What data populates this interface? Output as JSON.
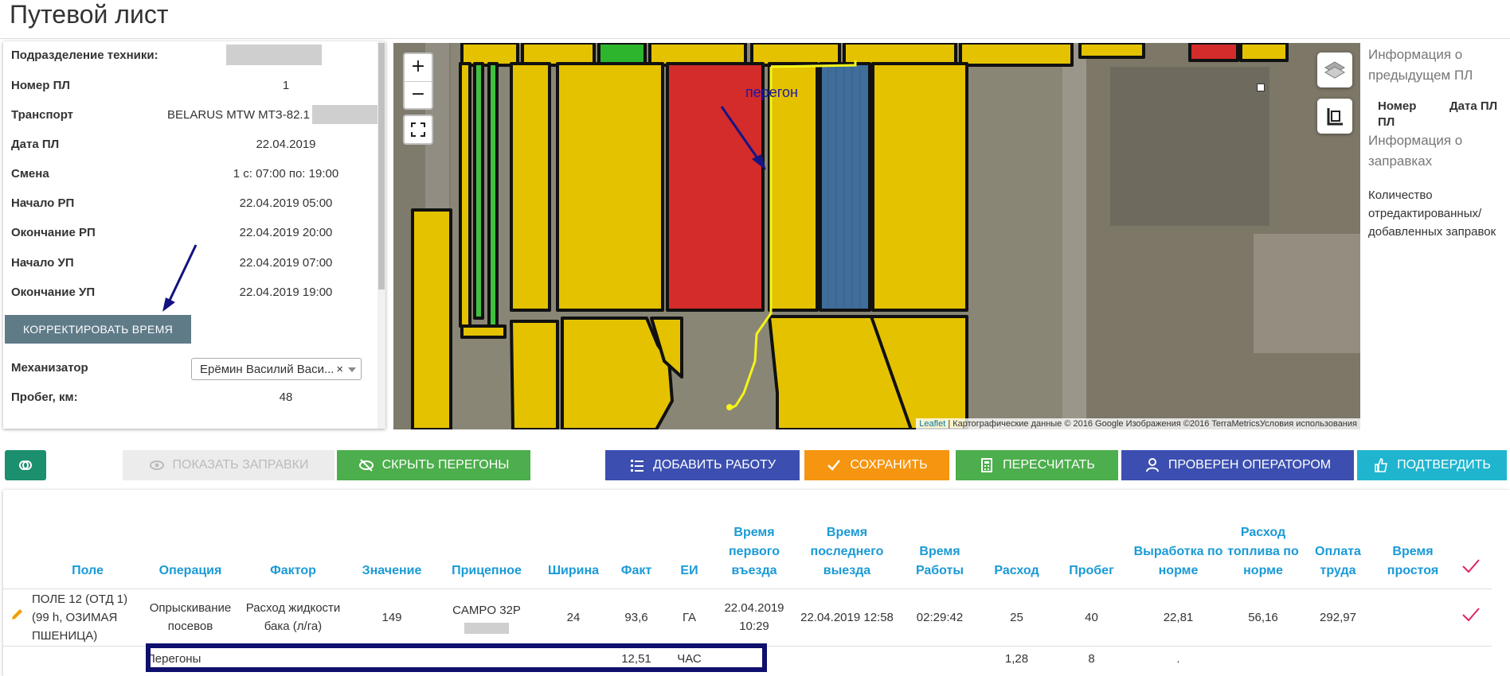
{
  "page": {
    "title": "Путевой лист"
  },
  "info": [
    {
      "label": "Подразделение техники:",
      "value": ""
    },
    {
      "label": "Номер ПЛ",
      "value": "1"
    },
    {
      "label": "Транспорт",
      "value": "BELARUS MTW МТЗ-82.1"
    },
    {
      "label": "Дата ПЛ",
      "value": "22.04.2019"
    },
    {
      "label": "Смена",
      "value": "1 с: 07:00 по: 19:00"
    },
    {
      "label": "Начало РП",
      "value": "22.04.2019 05:00"
    },
    {
      "label": "Окончание РП",
      "value": "22.04.2019 20:00"
    },
    {
      "label": "Начало УП",
      "value": "22.04.2019 07:00"
    },
    {
      "label": "Окончание УП",
      "value": "22.04.2019 19:00"
    }
  ],
  "correct_time_button": "КОРРЕКТИРОВАТЬ ВРЕМЯ",
  "mechanic": {
    "label": "Механизатор",
    "value": "Ерёмин Василий Васи...",
    "clear": "×"
  },
  "mileage": {
    "label": "Пробег, км:",
    "value": "48"
  },
  "map": {
    "zoom_in": "+",
    "zoom_out": "−",
    "annotation": "перегон",
    "attribution_link": "Leaflet",
    "attribution_text": " | Картографические данные © 2016 Google Изображения ©2016 TerraMetricsУсловия использования"
  },
  "right_info": {
    "prev_title": "Информация о предыдущем ПЛ",
    "col_number": "Номер ПЛ",
    "col_date": "Дата ПЛ",
    "fuel_title": "Информация о заправках",
    "edited_label": "Количество отредактированных/ добавленных заправок"
  },
  "toolbar": {
    "show_fuel": "ПОКАЗАТЬ ЗАПРАВКИ",
    "hide_transfers": "СКРЫТЬ ПЕРЕГОНЫ",
    "add_work": "ДОБАВИТЬ РАБОТУ",
    "save": "СОХРАНИТЬ",
    "recalc": "ПЕРЕСЧИТАТЬ",
    "checked": "ПРОВЕРЕН ОПЕРАТОРОМ",
    "confirm": "ПОДТВЕРДИТЬ"
  },
  "table": {
    "headers": [
      "Поле",
      "Операция",
      "Фактор",
      "Значение",
      "Прицепное",
      "Ширина",
      "Факт",
      "ЕИ",
      "Время первого въезда",
      "Время последнего выезда",
      "Время Работы",
      "Расход",
      "Пробег",
      "Выработка по норме",
      "Расход топлива по норме",
      "Оплата труда",
      "Время простоя"
    ],
    "row1": [
      "ПОЛЕ 12 (ОТД 1) (99 h, ОЗИМАЯ ПШЕНИЦА)",
      "Опрыскивание посевов",
      "Расход жидкости бака (л/га)",
      "149",
      "CAMPO 32P",
      "24",
      "93,6",
      "ГА",
      "22.04.2019 10:29",
      "22.04.2019 12:58",
      "02:29:42",
      "25",
      "40",
      "22,81",
      "56,16",
      "292,97",
      ""
    ],
    "row2": [
      "",
      "Перегоны",
      "",
      "",
      "",
      "",
      "12,51",
      "ЧАС",
      "",
      "",
      "",
      "1,28",
      "8",
      ".",
      "",
      "",
      ""
    ]
  },
  "colors": {
    "accent": "#1a9ad6",
    "check": "#e0245e",
    "highlight": "#0f0f6e"
  }
}
